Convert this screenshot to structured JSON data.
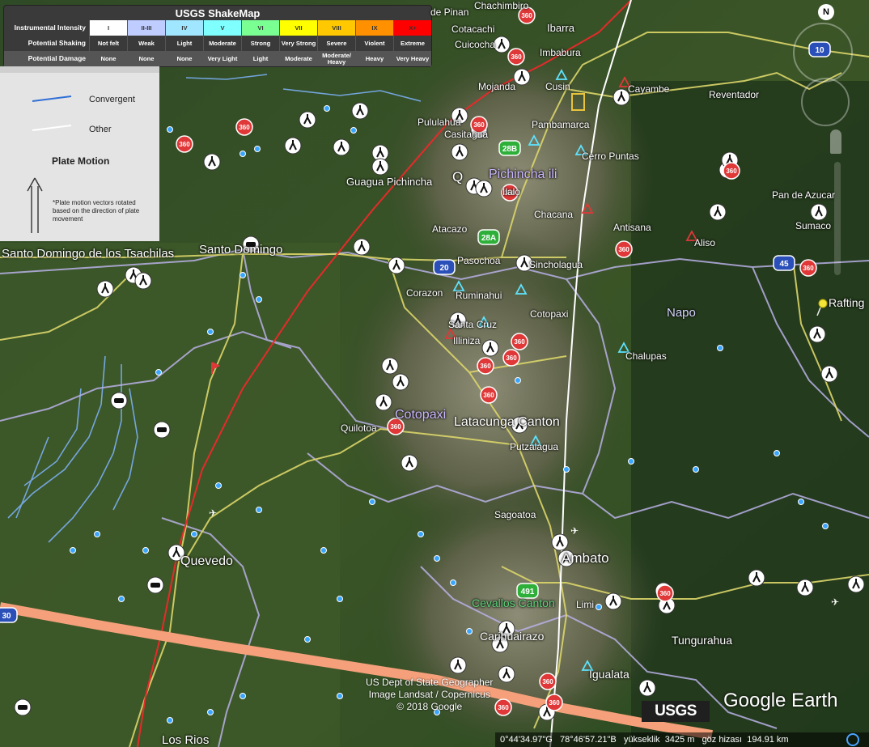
{
  "legend": {
    "title": "USGS ShakeMap",
    "rows": [
      {
        "header": "Instrumental Intensity",
        "cells": [
          "I",
          "II-III",
          "IV",
          "V",
          "VI",
          "VII",
          "VIII",
          "IX",
          "X+"
        ]
      },
      {
        "header": "Potential Shaking",
        "cells": [
          "Not felt",
          "Weak",
          "Light",
          "Moderate",
          "Strong",
          "Very Strong",
          "Severe",
          "Violent",
          "Extreme"
        ]
      },
      {
        "header": "Potential Damage",
        "cells": [
          "None",
          "None",
          "None",
          "Very Light",
          "Light",
          "Moderate",
          "Moderate/ Heavy",
          "Heavy",
          "Very Heavy"
        ]
      }
    ],
    "intensity_colors": [
      "#ffffff",
      "#bfccff",
      "#a0e6ff",
      "#80ffff",
      "#7aff93",
      "#ffff00",
      "#ffc800",
      "#ff9100",
      "#ff0000"
    ]
  },
  "plate_legend": {
    "convergent_label": "Convergent",
    "other_label": "Other",
    "title": "Plate Motion",
    "note": "*Plate motion vectors rotated based on the direction of plate movement",
    "convergent_color": "#2f6fd6",
    "other_color": "#ffffff"
  },
  "places": {
    "chachimbiro": "Chachimbiro",
    "pinan": "de Pinan",
    "ibarra": "Ibarra",
    "cotacachi": "Cotacachi",
    "cuicocha": "Cuicocha",
    "imbabura": "Imbabura",
    "mojanda": "Mojanda",
    "cusin": "Cusin",
    "cayambe": "Cayambe",
    "reventador": "Reventador",
    "pululahua": "Pululahua",
    "casitagua": "Casitagua",
    "pambamarca": "Pambamarca",
    "cerro_puntas": "Cerro Puntas",
    "guagua": "Guagua Pichincha",
    "quito_fragment": "Q",
    "pichincha": "Pichincha ili",
    "ilalo": "Ilalo",
    "chacana": "Chacana",
    "antisana": "Antisana",
    "aliso": "Aliso",
    "pan_de_azucar": "Pan de Azucar",
    "sumaco": "Sumaco",
    "atacazo": "Atacazo",
    "santo_domingo": "Santo Domingo",
    "tsachilas": "Santo Domingo de los Tsachilas",
    "pasochoa": "Pasochoa",
    "sincholagua": "Sincholagua",
    "corazon": "Corazon",
    "rumiñahui": "Ruminahui",
    "cotopaxi_volcano": "Cotopaxi",
    "napo": "Napo",
    "rafting": "Rafting",
    "santa_cruz": "Santa Cruz",
    "illiniza": "Illiniza",
    "chalupas": "Chalupas",
    "cotopaxi_province": "Cotopaxi",
    "quilotoa": "Quilotoa",
    "latacunga": "Latacunga Canton",
    "putzalagua": "Putzalagua",
    "sagoatoa": "Sagoatoa",
    "quevedo": "Quevedo",
    "ambato": "Ambato",
    "cevallos": "Cevallos Canton",
    "limi": "Limi",
    "carihuairazo": "Carihuairazo",
    "tungurahua": "Tungurahua",
    "igualata": "Igualata",
    "los_rios": "Los Rios"
  },
  "shields": {
    "r28b": "28B",
    "r28a": "28A",
    "r20": "20",
    "r45": "45",
    "r491": "491",
    "r30": "30",
    "r10": "10",
    "badge360": "360"
  },
  "credits": {
    "line1": "US Dept of State Geographer",
    "line2": "Image Landsat / Copernicus",
    "line3": "© 2018 Google"
  },
  "brand": {
    "usgs": "USGS",
    "google_earth": "Google Earth"
  },
  "compass": {
    "north": "N"
  },
  "status": {
    "lat": "0°44'34.97\"G",
    "lon": "78°46'57.21\"B",
    "elev_label": "yükseklik",
    "elev": "3425 m",
    "eye_label": "göz hizası",
    "eye": "194.91 km"
  }
}
